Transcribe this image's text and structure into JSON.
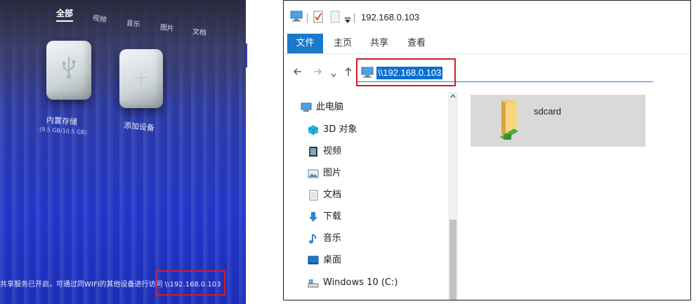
{
  "tv": {
    "tabs": [
      "全部",
      "视频",
      "音乐",
      "图片",
      "文档"
    ],
    "active_tab": "全部",
    "tiles": [
      {
        "label": "内置存储",
        "sublabel": "(9.5 GB/10.5 GB)",
        "icon": "usb-icon"
      },
      {
        "label": "添加设备",
        "sublabel": "",
        "icon": "plus-icon"
      }
    ],
    "status_text": "共享服务已开启，可通过同WIFI的其他设备进行访问 \\\\192.168.0.103",
    "highlight_color": "#d21e24"
  },
  "explorer": {
    "title": "192.168.0.103",
    "ribbon_tabs": [
      "文件",
      "主页",
      "共享",
      "查看"
    ],
    "address": "\\\\192.168.0.103",
    "nav_items": [
      {
        "label": "此电脑",
        "icon": "computer-icon"
      },
      {
        "label": "3D 对象",
        "icon": "3d-objects-icon"
      },
      {
        "label": "视频",
        "icon": "video-icon"
      },
      {
        "label": "图片",
        "icon": "pictures-icon"
      },
      {
        "label": "文档",
        "icon": "documents-icon"
      },
      {
        "label": "下载",
        "icon": "download-icon"
      },
      {
        "label": "音乐",
        "icon": "music-icon"
      },
      {
        "label": "桌面",
        "icon": "desktop-icon"
      },
      {
        "label": "Windows 10 (C:)",
        "icon": "drive-icon"
      }
    ],
    "folders": [
      {
        "name": "sdcard",
        "icon": "network-folder-icon"
      }
    ],
    "accent_color": "#1979ca"
  }
}
